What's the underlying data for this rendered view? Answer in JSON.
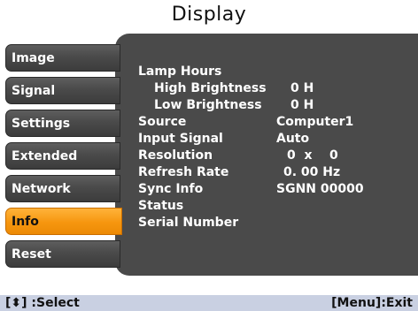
{
  "title": "Display",
  "tabs": [
    {
      "label": "Image",
      "active": false
    },
    {
      "label": "Signal",
      "active": false
    },
    {
      "label": "Settings",
      "active": false
    },
    {
      "label": "Extended",
      "active": false
    },
    {
      "label": "Network",
      "active": false
    },
    {
      "label": "Info",
      "active": true
    },
    {
      "label": "Reset",
      "active": false
    }
  ],
  "info": {
    "lamp_hours": "Lamp Hours",
    "high_brightness": {
      "label": "High Brightness",
      "value": "0 H"
    },
    "low_brightness": {
      "label": "Low Brightness",
      "value": "0 H"
    },
    "source": {
      "label": "Source",
      "value": "Computer1"
    },
    "input_signal": {
      "label": "Input Signal",
      "value": "Auto"
    },
    "resolution": {
      "label": "Resolution",
      "value": "0  x    0"
    },
    "refresh_rate": {
      "label": "Refresh Rate",
      "value": "0. 00 Hz"
    },
    "sync_info": {
      "label": "Sync Info",
      "value": "SGNN 00000"
    },
    "status": {
      "label": "Status",
      "value": ""
    },
    "serial_number": {
      "label": "Serial Number",
      "value": ""
    }
  },
  "footer": {
    "left": "[⬍] :Select",
    "right": "[Menu]:Exit"
  },
  "colors": {
    "active_tab": "#f6960f",
    "tab": "#4a4a4a",
    "panel": "#4a4a4a",
    "footer": "#c9d0e2"
  }
}
